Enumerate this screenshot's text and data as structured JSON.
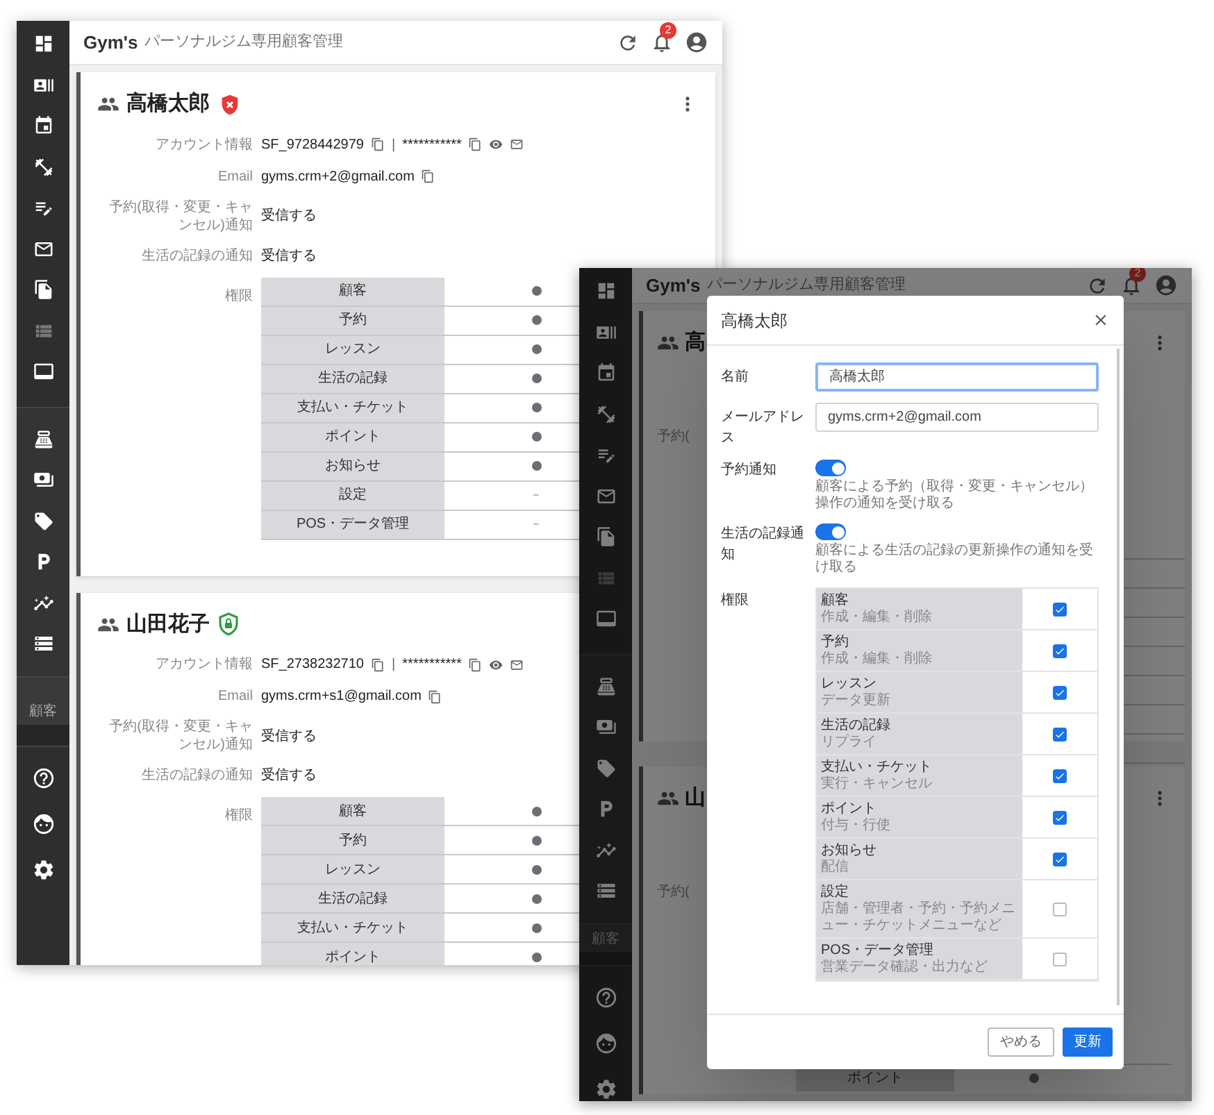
{
  "back_window": {
    "app_title": "Gym's",
    "app_subtitle": "パーソナルジム専用顧客管理",
    "notification_count": "2",
    "sidebar": {
      "items": [
        {
          "disabled": false
        },
        {
          "disabled": false
        },
        {
          "disabled": false
        },
        {
          "disabled": false
        },
        {
          "disabled": false
        },
        {
          "disabled": false
        },
        {
          "disabled": false
        },
        {
          "disabled": true
        },
        {
          "disabled": false
        },
        {
          "disabled": false
        },
        {
          "disabled": false
        },
        {
          "disabled": false
        },
        {
          "disabled": false
        },
        {
          "disabled": false
        },
        {
          "disabled": false
        }
      ],
      "section_label": "顧客"
    },
    "customers": [
      {
        "name": "高橋太郎",
        "blocked": true,
        "labels": {
          "account": "アカウント情報",
          "email": "Email",
          "reserve_notify": "予約(取得・変更・キャンセル)通知",
          "life_notify": "生活の記録の通知",
          "permissions": "権限"
        },
        "account_id": "SF_9728442979",
        "password": "***********",
        "separator": "|",
        "email": "gyms.crm+2@gmail.com",
        "reserve_notify": "受信する",
        "life_notify": "受信する",
        "permissions": [
          {
            "name": "顧客",
            "granted": true
          },
          {
            "name": "予約",
            "granted": true
          },
          {
            "name": "レッスン",
            "granted": true
          },
          {
            "name": "生活の記録",
            "granted": true
          },
          {
            "name": "支払い・チケット",
            "granted": true
          },
          {
            "name": "ポイント",
            "granted": true
          },
          {
            "name": "お知らせ",
            "granted": true
          },
          {
            "name": "設定",
            "granted": false
          },
          {
            "name": "POS・データ管理",
            "granted": false
          }
        ]
      },
      {
        "name": "山田花子",
        "blocked": false,
        "labels": {
          "account": "アカウント情報",
          "email": "Email",
          "reserve_notify": "予約(取得・変更・キャンセル)通知",
          "life_notify": "生活の記録の通知",
          "permissions": "権限"
        },
        "account_id": "SF_2738232710",
        "password": "***********",
        "separator": "|",
        "email": "gyms.crm+s1@gmail.com",
        "reserve_notify": "受信する",
        "life_notify": "受信する",
        "permissions": [
          {
            "name": "顧客",
            "granted": true
          },
          {
            "name": "予約",
            "granted": true
          },
          {
            "name": "レッスン",
            "granted": true
          },
          {
            "name": "生活の記録",
            "granted": true
          },
          {
            "name": "支払い・チケット",
            "granted": true
          },
          {
            "name": "ポイント",
            "granted": true
          }
        ]
      }
    ]
  },
  "front_window": {
    "app_title": "Gym's",
    "app_subtitle": "パーソナルジム専用顧客管理",
    "notification_count": "2",
    "sidebar": {
      "items": [
        {
          "disabled": false
        },
        {
          "disabled": false
        },
        {
          "disabled": false
        },
        {
          "disabled": false
        },
        {
          "disabled": false
        },
        {
          "disabled": false
        },
        {
          "disabled": false
        },
        {
          "disabled": true
        },
        {
          "disabled": false
        },
        {
          "disabled": false
        },
        {
          "disabled": false
        },
        {
          "disabled": false
        },
        {
          "disabled": false
        },
        {
          "disabled": false
        },
        {
          "disabled": false
        }
      ],
      "section_label": "顧客"
    },
    "cards": [
      {
        "name": "高",
        "label": "予約("
      },
      {
        "name": "山",
        "label": "予約(",
        "permission_row": {
          "name": "ポイント",
          "granted": true
        }
      }
    ],
    "dialog": {
      "title": "高橋太郎",
      "fields": [
        {
          "label": "名前",
          "value": "高橋太郎",
          "focused": true
        },
        {
          "label": "メールアドレス",
          "value": "gyms.crm+2@gmail.com",
          "focused": false
        }
      ],
      "toggles": [
        {
          "label": "予約通知",
          "on": true,
          "description": "顧客による予約（取得・変更・キャンセル）操作の通知を受け取る"
        },
        {
          "label": "生活の記録通知",
          "on": true,
          "description": "顧客による生活の記録の更新操作の通知を受け取る"
        }
      ],
      "permissions_label": "権限",
      "permissions": [
        {
          "name": "顧客",
          "description": "作成・編集・削除",
          "checked": true
        },
        {
          "name": "予約",
          "description": "作成・編集・削除",
          "checked": true
        },
        {
          "name": "レッスン",
          "description": "データ更新",
          "checked": true
        },
        {
          "name": "生活の記録",
          "description": "リプライ",
          "checked": true
        },
        {
          "name": "支払い・チケット",
          "description": "実行・キャンセル",
          "checked": true
        },
        {
          "name": "ポイント",
          "description": "付与・行使",
          "checked": true
        },
        {
          "name": "お知らせ",
          "description": "配信",
          "checked": true
        },
        {
          "name": "設定",
          "description": "店舗・管理者・予約・予約メニュー・チケットメニューなど",
          "checked": false
        },
        {
          "name": "POS・データ管理",
          "description": "営業データ確認・出力など",
          "checked": false
        }
      ],
      "buttons": [
        {
          "label": "やめる",
          "kind": "secondary"
        },
        {
          "label": "更新",
          "kind": "primary"
        }
      ]
    }
  }
}
